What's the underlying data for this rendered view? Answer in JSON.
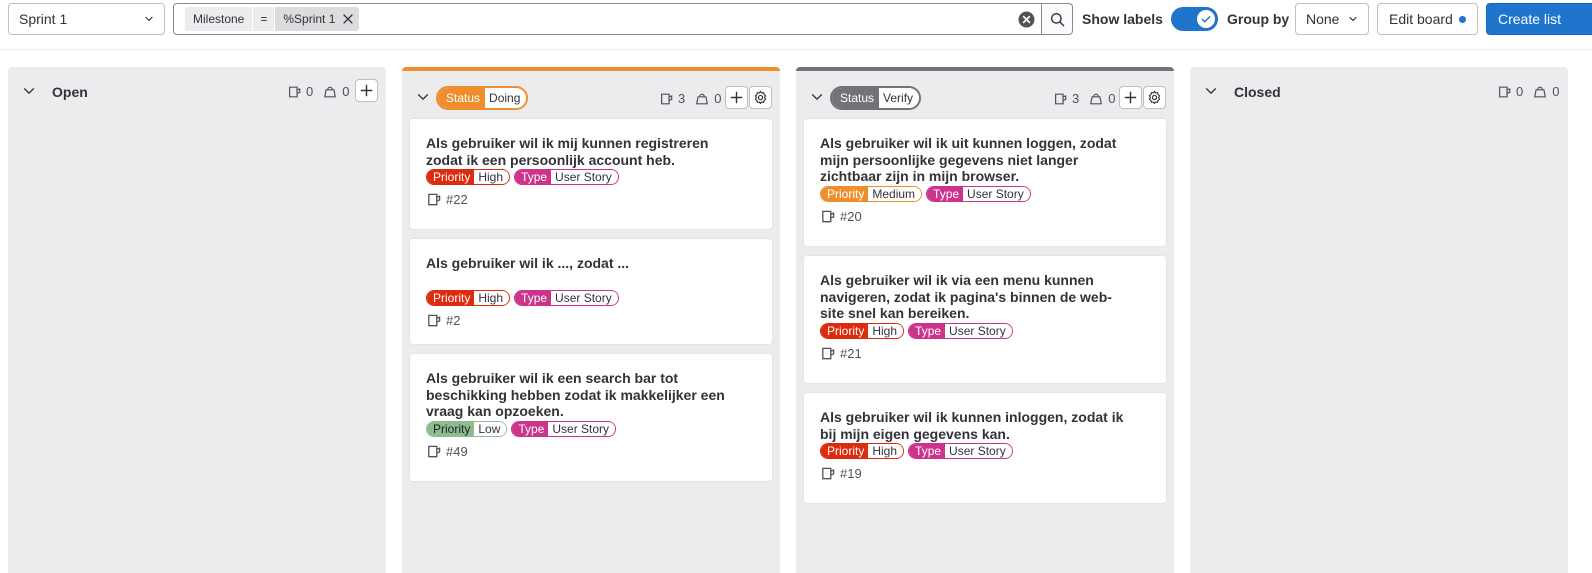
{
  "toolbar": {
    "milestone_select": "Sprint 1",
    "filter": {
      "key": "Milestone",
      "operator": "=",
      "value": "%Sprint 1"
    },
    "show_labels": "Show labels",
    "show_labels_on": true,
    "group_by_label": "Group by",
    "group_by_value": "None",
    "edit_board": "Edit board",
    "create_list": "Create list"
  },
  "colors": {
    "priority_high": "#dd2b0e",
    "priority_medium": "#ef8e2f",
    "priority_low": "#8fbc8f",
    "type": "#cc338b",
    "doing": "#ef8e2f",
    "verify": "#737278",
    "accent": "#1f75cb"
  },
  "lists": [
    {
      "title": "Open",
      "issues": "0",
      "weight": "0"
    },
    {
      "status_key": "Status",
      "status_value": "Doing",
      "issues": "3",
      "weight": "0",
      "cards": [
        {
          "title": "Als gebruiker wil ik mij kunnen registreren zodat ik een persoonlijk account heb.",
          "priority_key": "Priority",
          "priority": "High",
          "type_key": "Type",
          "type": "User Story",
          "ref": "#22"
        },
        {
          "title": "Als gebruiker wil ik ..., zodat ...",
          "priority_key": "Priority",
          "priority": "High",
          "type_key": "Type",
          "type": "User Story",
          "ref": "#2"
        },
        {
          "title": "Als gebruiker wil ik een search bar tot beschikking hebben zodat ik makkelijker een vraag kan opzoeken.",
          "priority_key": "Priority",
          "priority": "Low",
          "type_key": "Type",
          "type": "User Story",
          "ref": "#49"
        }
      ]
    },
    {
      "status_key": "Status",
      "status_value": "Verify",
      "issues": "3",
      "weight": "0",
      "cards": [
        {
          "title": "Als gebruiker wil ik uit kunnen loggen, zodat mijn persoonlijke gegevens niet langer zichtbaar zijn in mijn browser.",
          "priority_key": "Priority",
          "priority": "Medium",
          "type_key": "Type",
          "type": "User Story",
          "ref": "#20"
        },
        {
          "title": "Als gebruiker wil ik via een menu kunnen navigeren, zodat ik pagina's binnen de web-site snel kan bereiken.",
          "priority_key": "Priority",
          "priority": "High",
          "type_key": "Type",
          "type": "User Story",
          "ref": "#21"
        },
        {
          "title": "Als gebruiker wil ik kunnen inloggen, zodat ik bij mijn eigen gegevens kan.",
          "priority_key": "Priority",
          "priority": "High",
          "type_key": "Type",
          "type": "User Story",
          "ref": "#19"
        }
      ]
    },
    {
      "title": "Closed",
      "issues": "0",
      "weight": "0"
    }
  ]
}
